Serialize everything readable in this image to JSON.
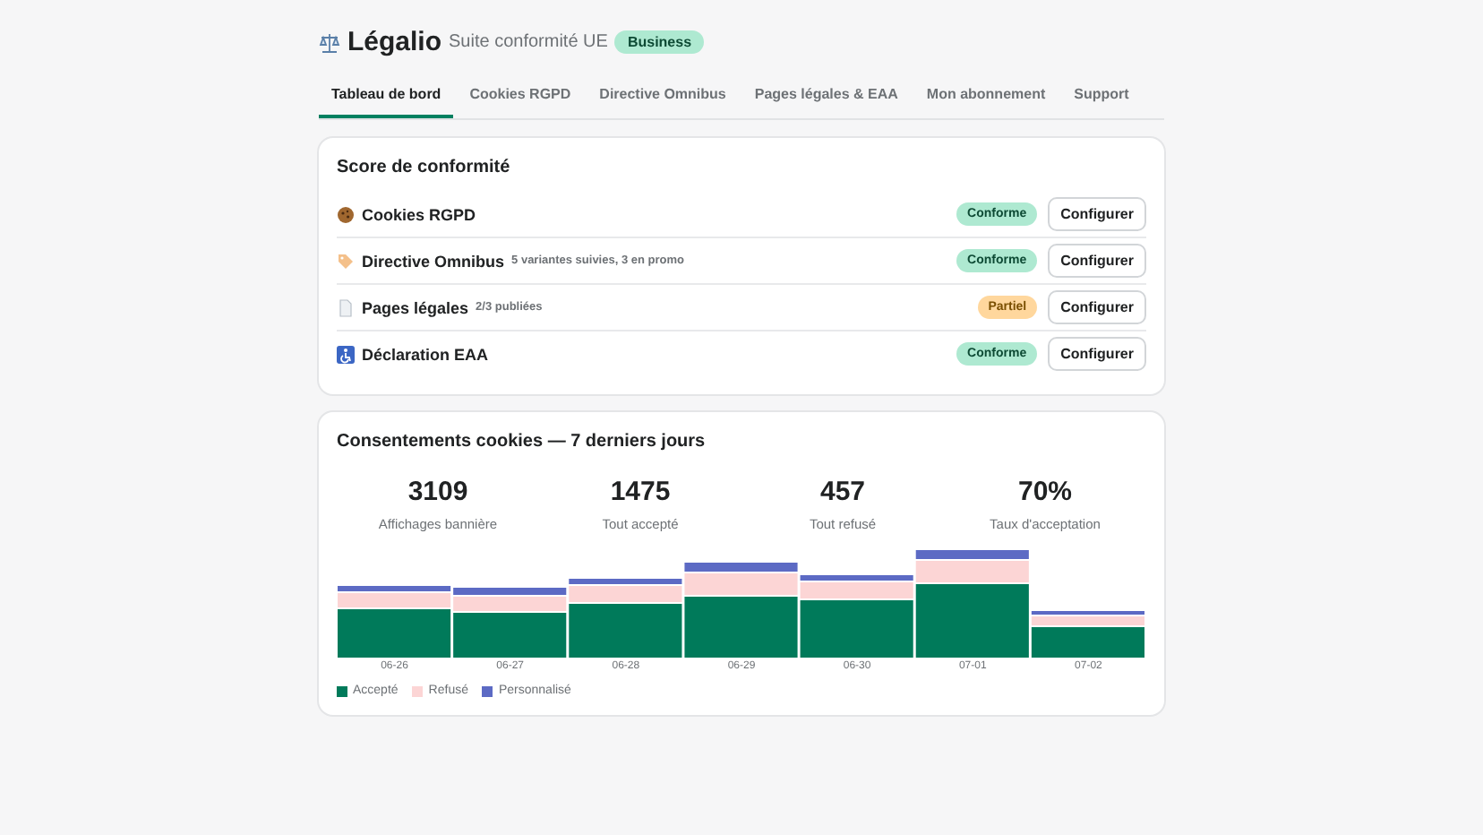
{
  "header": {
    "title": "Légalio",
    "subtitle": "Suite conformité UE",
    "plan": "Business"
  },
  "tabs": [
    {
      "label": "Tableau de bord",
      "selected": true
    },
    {
      "label": "Cookies RGPD",
      "selected": false
    },
    {
      "label": "Directive Omnibus",
      "selected": false
    },
    {
      "label": "Pages légales & EAA",
      "selected": false
    },
    {
      "label": "Mon abonnement",
      "selected": false
    },
    {
      "label": "Support",
      "selected": false
    }
  ],
  "score_card": {
    "title": "Score de conformité",
    "items": [
      {
        "kind": "cookie",
        "name": "Cookies RGPD",
        "status": "Conforme",
        "compliant": true,
        "action": "Configurer"
      },
      {
        "kind": "tag",
        "name": "Directive Omnibus",
        "detail": "5 variantes suivies, 3 en promo",
        "status": "Conforme",
        "compliant": true,
        "action": "Configurer"
      },
      {
        "kind": "document",
        "name": "Pages légales",
        "detail": "2/3 publiées",
        "status": "Partiel",
        "compliant": false,
        "action": "Configurer"
      },
      {
        "kind": "accessibility",
        "name": "Déclaration EAA",
        "status": "Conforme",
        "compliant": true,
        "action": "Configurer"
      }
    ]
  },
  "consent_card": {
    "title": "Consentements cookies — 7 derniers jours",
    "stats": [
      {
        "value": "3109",
        "label": "Affichages bannière"
      },
      {
        "value": "1475",
        "label": "Tout accepté"
      },
      {
        "value": "457",
        "label": "Tout refusé"
      },
      {
        "value": "70%",
        "label": "Taux d'acceptation"
      }
    ],
    "chart_days": [
      "06-26",
      "06-27",
      "06-28",
      "06-29",
      "06-30",
      "07-01",
      "07-02"
    ],
    "legend": [
      {
        "label": "Accepté",
        "color": "#007a5a"
      },
      {
        "label": "Refusé",
        "color": "#fcd5d5"
      },
      {
        "label": "Personnalisé",
        "color": "#5c6ac4"
      }
    ]
  }
}
